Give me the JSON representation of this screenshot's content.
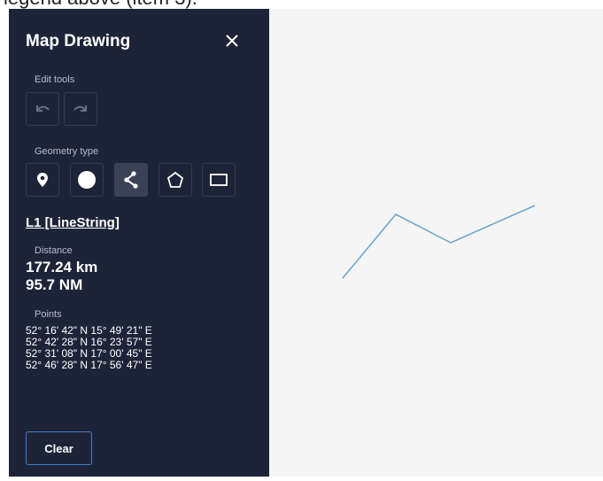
{
  "caption": "legend above (item 3).",
  "panel": {
    "title": "Map Drawing",
    "edit_tools_label": "Edit tools",
    "undo_icon": "undo-icon",
    "redo_icon": "redo-icon",
    "geometry_type_label": "Geometry type",
    "geometry_types": [
      {
        "icon": "marker-icon",
        "active": false
      },
      {
        "icon": "circle-icon",
        "active": false
      },
      {
        "icon": "linestring-icon",
        "active": true
      },
      {
        "icon": "polygon-icon",
        "active": false
      },
      {
        "icon": "rectangle-icon",
        "active": false
      }
    ],
    "feature_name": "L1 [LineString]",
    "distance_label": "Distance",
    "distance_km": "177.24 km",
    "distance_nm": "95.7 NM",
    "points_label": "Points",
    "points": [
      "52° 16' 42\" N 15° 49' 21\" E",
      "52° 42' 28\" N 16° 23' 57\" E",
      "52° 31' 08\" N 17° 00' 45\" E",
      "52° 46' 28\" N 17° 56' 47\" E"
    ],
    "clear_label": "Clear"
  },
  "colors": {
    "panel_bg": "#1e2438",
    "line": "#6fa8cf",
    "accent_border": "#3f7fc4"
  }
}
